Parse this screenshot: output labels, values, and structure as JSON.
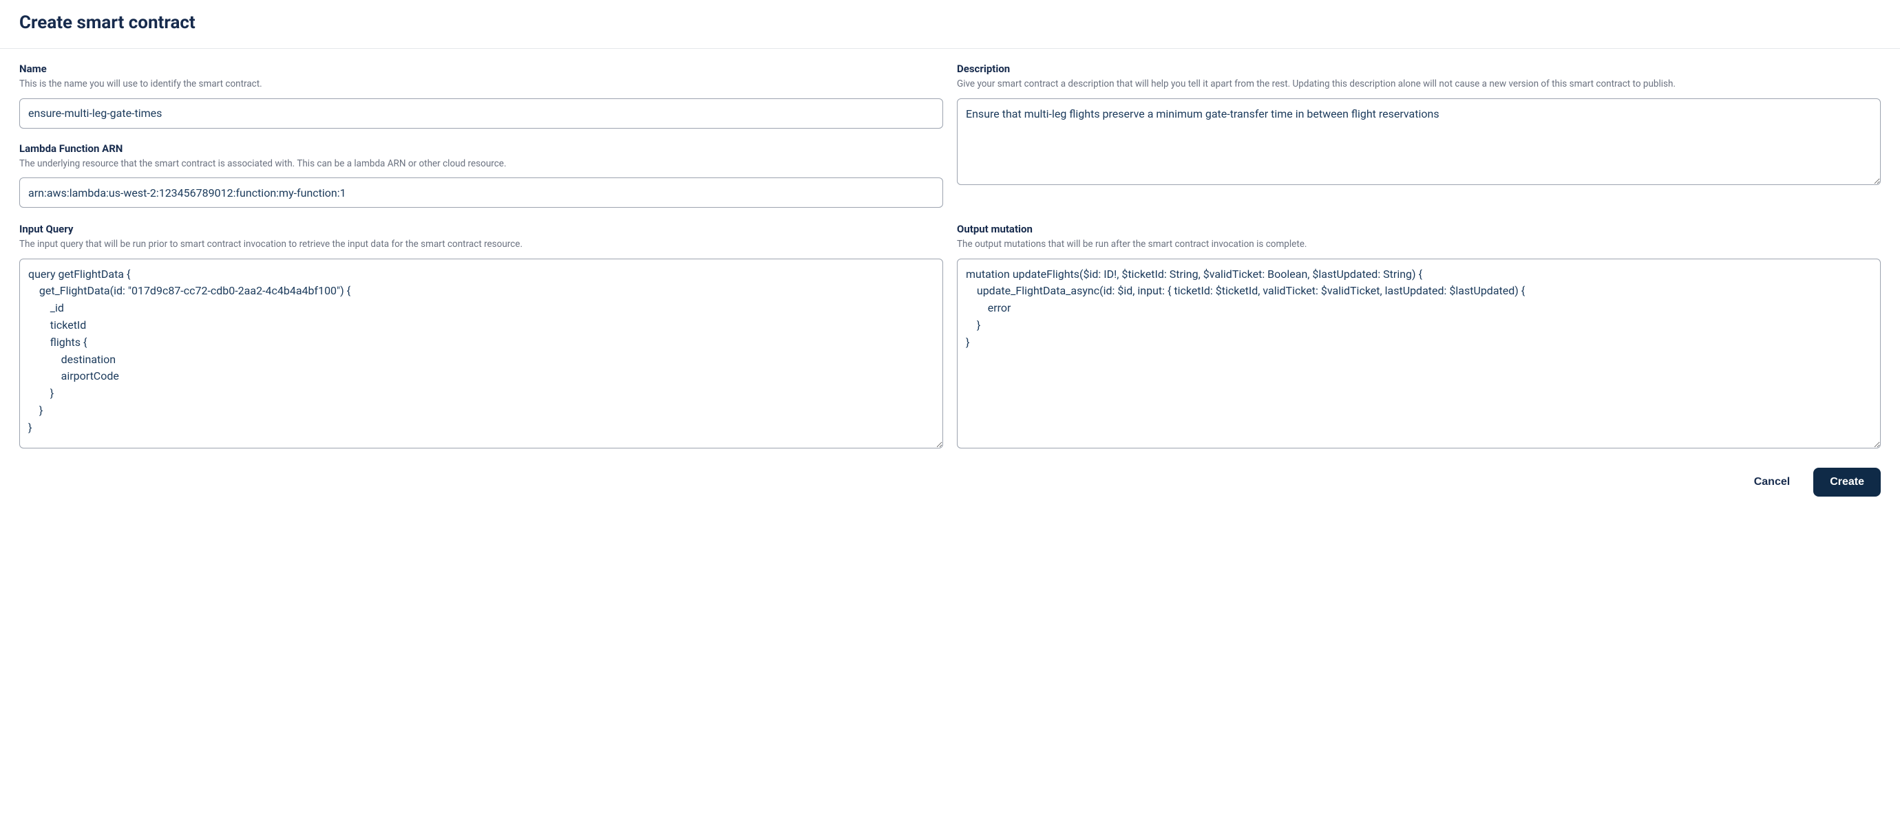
{
  "header": {
    "title": "Create smart contract"
  },
  "fields": {
    "name": {
      "label": "Name",
      "help": "This is the name you will use to identify the smart contract.",
      "value": "ensure-multi-leg-gate-times"
    },
    "arn": {
      "label": "Lambda Function ARN",
      "help": "The underlying resource that the smart contract is associated with. This can be a lambda ARN or other cloud resource.",
      "value": "arn:aws:lambda:us-west-2:123456789012:function:my-function:1"
    },
    "description": {
      "label": "Description",
      "help": "Give your smart contract a description that will help you tell it apart from the rest. Updating this description alone will not cause a new version of this smart contract to publish.",
      "value": "Ensure that multi-leg flights preserve a minimum gate-transfer time in between flight reservations"
    },
    "inputQuery": {
      "label": "Input Query",
      "help": "The input query that will be run prior to smart contract invocation to retrieve the input data for the smart contract resource.",
      "value": "query getFlightData {\n    get_FlightData(id: \"017d9c87-cc72-cdb0-2aa2-4c4b4a4bf100\") {\n        _id\n        ticketId\n        flights {\n            destination\n            airportCode\n        }\n    }\n}"
    },
    "outputMutation": {
      "label": "Output mutation",
      "help": "The output mutations that will be run after the smart contract invocation is complete.",
      "value": "mutation updateFlights($id: ID!, $ticketId: String, $validTicket: Boolean, $lastUpdated: String) {\n    update_FlightData_async(id: $id, input: { ticketId: $ticketId, validTicket: $validTicket, lastUpdated: $lastUpdated) {\n        error\n    }\n}"
    }
  },
  "footer": {
    "cancel": "Cancel",
    "create": "Create"
  }
}
